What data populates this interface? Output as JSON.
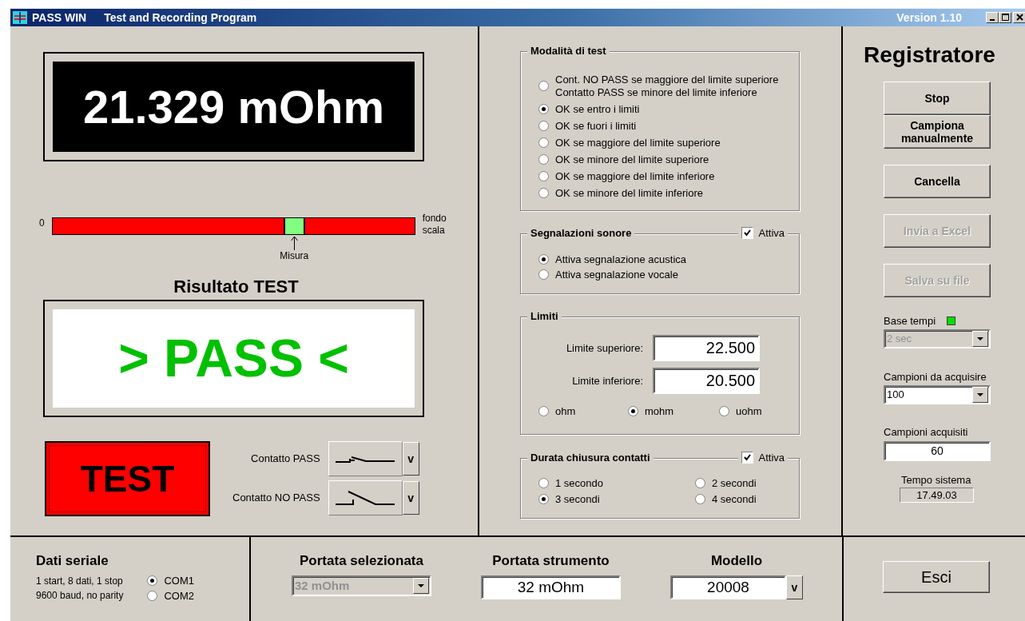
{
  "window": {
    "app_name": "PASS WIN",
    "title": "Test and Recording Program",
    "version": "Version 1.10"
  },
  "reading": "21.329 mOhm",
  "meter": {
    "min_label": "0",
    "max_label": "fondo scala",
    "marker_label": "Misura",
    "level": 0.668
  },
  "result": {
    "title": "Risultato TEST",
    "text": "> PASS <",
    "kind": "pass"
  },
  "test_button": "TEST",
  "contacts": [
    {
      "label": "Contatto PASS",
      "closed": true,
      "button": "v"
    },
    {
      "label": "Contatto NO PASS",
      "closed": false,
      "button": "v"
    }
  ],
  "test_mode": {
    "title": "Modalità di test",
    "options": [
      {
        "label": "Cont. NO PASS se maggiore del limite superiore\nContatto PASS se minore del limite inferiore",
        "selected": false
      },
      {
        "label": "OK se entro i limiti",
        "selected": true
      },
      {
        "label": "OK se fuori i limiti",
        "selected": false
      },
      {
        "label": "OK se maggiore del limite superiore",
        "selected": false
      },
      {
        "label": "OK se minore del limite superiore",
        "selected": false
      },
      {
        "label": "OK se maggiore del limite inferiore",
        "selected": false
      },
      {
        "label": "OK se minore del limite inferiore",
        "selected": false
      }
    ]
  },
  "sound": {
    "title": "Segnalazioni sonore",
    "enable_label": "Attiva",
    "enabled": true,
    "options": [
      {
        "label": "Attiva segnalazione acustica",
        "selected": true
      },
      {
        "label": "Attiva segnalazione vocale",
        "selected": false
      }
    ]
  },
  "limits": {
    "title": "Limiti",
    "fields": [
      {
        "label": "Limite superiore:",
        "value": "22.500"
      },
      {
        "label": "Limite inferiore:",
        "value": "20.500"
      }
    ],
    "units": [
      {
        "label": "ohm",
        "selected": false
      },
      {
        "label": "mohm",
        "selected": true
      },
      {
        "label": "uohm",
        "selected": false
      }
    ]
  },
  "contact_duration": {
    "title": "Durata chiusura contatti",
    "enable_label": "Attiva",
    "enabled": true,
    "options": [
      {
        "label": "1 secondo",
        "selected": false
      },
      {
        "label": "2 secondi",
        "selected": false
      },
      {
        "label": "3 secondi",
        "selected": true
      },
      {
        "label": "4 secondi",
        "selected": false
      }
    ]
  },
  "recorder": {
    "title": "Registratore",
    "button_groups": [
      [
        {
          "label": "Stop",
          "disabled": false
        },
        {
          "label": "Campiona manualmente",
          "disabled": false
        }
      ],
      [
        {
          "label": "Cancella",
          "disabled": false
        }
      ],
      [
        {
          "label": "Invia a Excel",
          "disabled": true
        }
      ],
      [
        {
          "label": "Salva su file",
          "disabled": true
        }
      ]
    ],
    "time_base": {
      "label": "Base tempi",
      "indicator_on": true,
      "value": "2 sec",
      "disabled": true
    },
    "samples_to_acquire": {
      "label": "Campioni da acquisire",
      "value": "100",
      "disabled": false
    },
    "samples_acquired": {
      "label": "Campioni acquisiti",
      "value": "60"
    },
    "system_time": {
      "label": "Tempo sistema",
      "value": "17.49.03"
    }
  },
  "serial": {
    "title": "Dati seriale",
    "lines": [
      "1 start, 8 dati, 1 stop",
      "9600 baud, no parity"
    ],
    "ports": [
      {
        "label": "COM1",
        "selected": true
      },
      {
        "label": "COM2",
        "selected": false
      }
    ]
  },
  "selected_range": {
    "label": "Portata selezionata",
    "value": "32 mOhm",
    "disabled": true
  },
  "instrument_range": {
    "label": "Portata strumento",
    "value": "32 mOhm"
  },
  "model": {
    "label": "Modello",
    "value": "20008",
    "button": "v"
  },
  "exit_button": "Esci"
}
